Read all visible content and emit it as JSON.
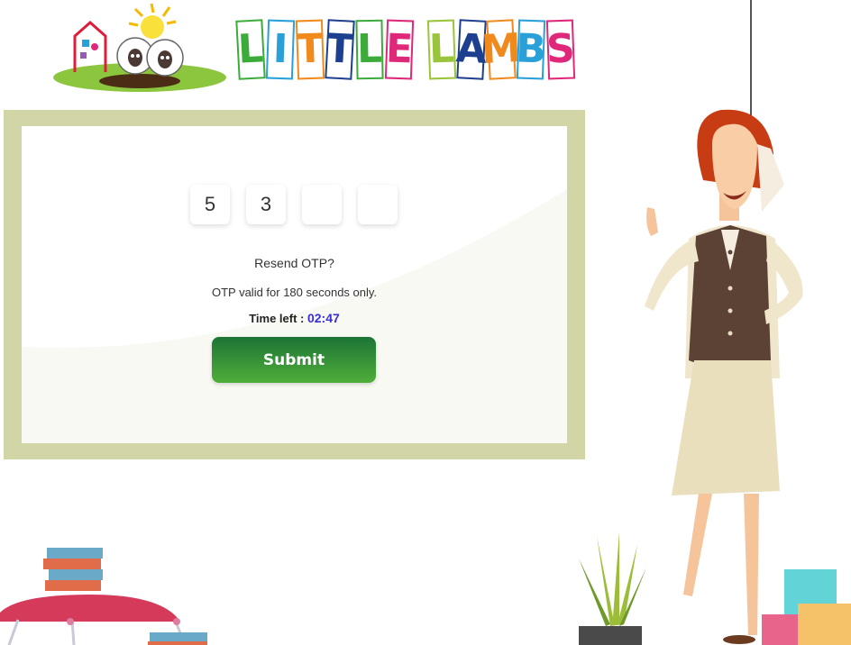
{
  "brand": {
    "letters": [
      {
        "char": "L",
        "color": "#3cab3a"
      },
      {
        "char": "I",
        "color": "#2aa0d8"
      },
      {
        "char": "T",
        "color": "#f08a1c"
      },
      {
        "char": "T",
        "color": "#1d3f8f"
      },
      {
        "char": "L",
        "color": "#3cab3a"
      },
      {
        "char": "E",
        "color": "#e0287a"
      },
      {
        "char": " ",
        "color": ""
      },
      {
        "char": "L",
        "color": "#9ac43c"
      },
      {
        "char": "A",
        "color": "#1d3f8f"
      },
      {
        "char": "M",
        "color": "#f08a1c"
      },
      {
        "char": "B",
        "color": "#2aa0d8"
      },
      {
        "char": "S",
        "color": "#e0287a"
      }
    ]
  },
  "otp": {
    "digits": [
      "5",
      "3",
      "",
      ""
    ],
    "resend_label": "Resend OTP?",
    "validity_text": "OTP valid for 180 seconds only.",
    "time_left_label": "Time left : ",
    "time_left_value": "02:47",
    "submit_label": "Submit"
  },
  "colors": {
    "board_frame": "#d2d6a6",
    "submit_top": "#1c7436",
    "submit_bottom": "#4fae3a",
    "timer_value": "#3a2fd0"
  }
}
